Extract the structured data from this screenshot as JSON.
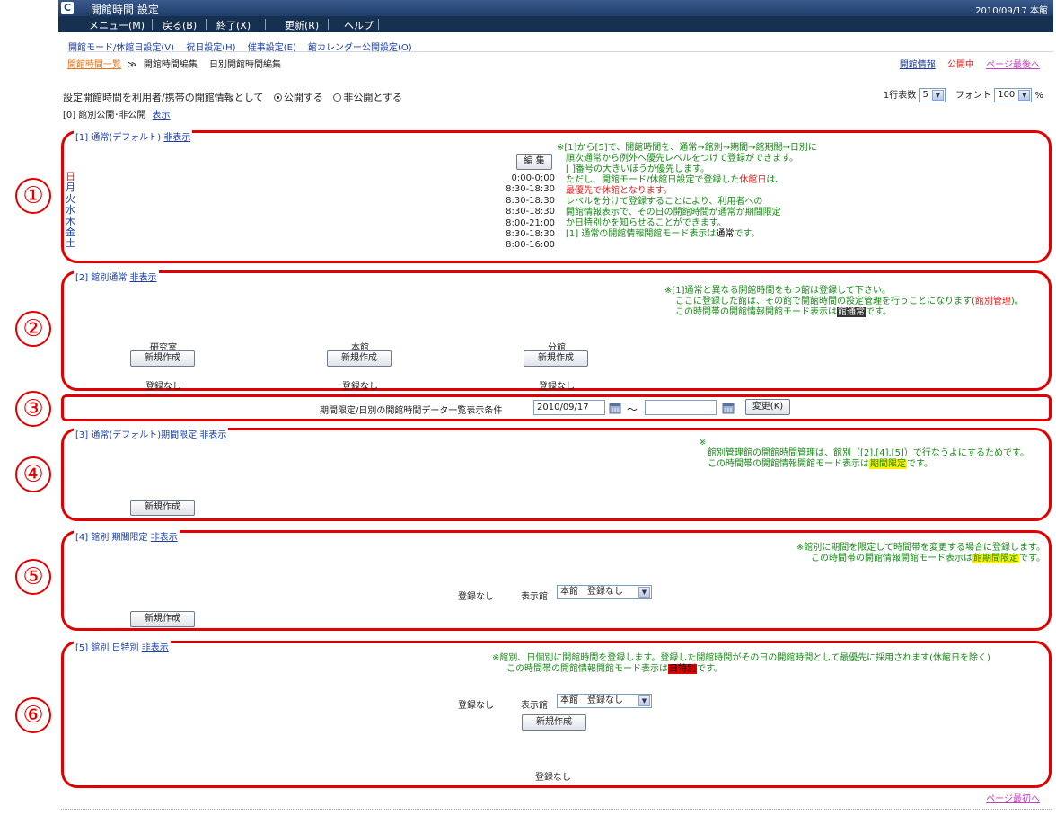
{
  "window": {
    "title": "開館時間 設定",
    "datetime": "2010/09/17 本館",
    "logo": "C"
  },
  "menu": [
    {
      "label": "メニュー(M)"
    },
    {
      "label": "戻る(B)"
    },
    {
      "label": "終了(X)"
    },
    {
      "label": "更新(R)"
    },
    {
      "label": "ヘルプ"
    }
  ],
  "sublinks": [
    "開館モード/休館日設定(V)",
    "祝日設定(H)",
    "催事設定(E)",
    "館カレンダー公開設定(O)"
  ],
  "breadcrumb": {
    "current": "開館時間一覧",
    "sep": "≫",
    "item1": "開館時間編集",
    "item2": "日別開館時間編集"
  },
  "topright": {
    "info_link": "開館情報",
    "status": "公開中",
    "bottom_link": "ページ最後へ"
  },
  "publish": {
    "label": "設定開館時間を利用者/携帯の開館情報として",
    "opt_public": "公開する",
    "opt_private": "非公開とする",
    "selected": "public"
  },
  "display_opts": {
    "rows_label": "1行表数",
    "rows_value": "5",
    "font_label": "フォント",
    "font_value": "100",
    "font_unit": "%"
  },
  "section0": {
    "label": "[0] 館別公開･非公開",
    "link": "表示"
  },
  "section1": {
    "head": "[1] 通常(デフォルト)",
    "toggle": "非表示",
    "edit_button": "編 集",
    "days": [
      "日",
      "月",
      "火",
      "水",
      "木",
      "金",
      "土"
    ],
    "times": [
      "0:00-0:00",
      "8:30-18:30",
      "8:30-18:30",
      "8:30-18:30",
      "8:00-21:00",
      "8:30-18:30",
      "8:00-16:00"
    ],
    "note": {
      "l1": "※[1]から[5]で、開館時間を、通常→館別→期間→館期間→日別に",
      "l2": "順次通常から例外へ優先レベルをつけて登録ができます。",
      "l3": "[ ]番号の大きいほうが優先します。",
      "l4a": "ただし、開館モード/休館日設定で登録した",
      "l4b": "休館日",
      "l4c": "は、",
      "l5": "最優先で休館となります。",
      "l6": "レベルを分けて登録することにより、利用者への",
      "l7": "開館情報表示で、その日の開館時間が通常か期間限定",
      "l8": "か日特別かを知らせることができます。",
      "l9a": "[1] 通常の開館情報開館モード表示は",
      "l9b": "通常",
      "l9c": "です。"
    }
  },
  "section2": {
    "head": "[2] 館別通常",
    "toggle": "非表示",
    "note": {
      "l1": "※[1]通常と異なる開館時間をもつ館は登録して下さい。",
      "l2a": "ここに登録した館は、その館で開館時間の設定管理を行うことになります(",
      "l2b": "館別管理",
      "l2c": ")。",
      "l3a": "この時間帯の開館情報開館モード表示は",
      "l3b": "館通常",
      "l3c": "です。"
    },
    "branches": [
      {
        "name": "研究室",
        "button": "新規作成",
        "status": "登録なし"
      },
      {
        "name": "本館",
        "button": "新規作成",
        "status": "登録なし"
      },
      {
        "name": "分館",
        "button": "新規作成",
        "status": "登録なし"
      }
    ]
  },
  "section3": {
    "label": "期間限定/日別の開館時間データ一覧表示条件",
    "date_from": "2010/09/17",
    "tilde": "～",
    "date_to": "",
    "button": "変更(K)"
  },
  "section4": {
    "head": "[3] 通常(デフォルト)期間限定",
    "toggle": "非表示",
    "note": {
      "l1": "※",
      "l2": "館別管理館の開館時間管理は、館別（[2],[4],[5]）で行なうよにするためです。",
      "l3a": "この時間帯の開館情報開館モード表示は",
      "l3b": "期間限定",
      "l3c": "です。"
    },
    "button": "新規作成"
  },
  "section5": {
    "head": "[4] 館別 期間限定",
    "toggle": "非表示",
    "note": {
      "l1": "※館別に期間を限定して時間帯を変更する場合に登録します。",
      "l2a": "この時間帯の開館情報開館モード表示は",
      "l2b": "館期間限定",
      "l2c": "です。"
    },
    "status": "登録なし",
    "lib_label": "表示館",
    "lib_value": "本館　登録なし",
    "button": "新規作成"
  },
  "section6": {
    "head": "[5] 館別 日特別",
    "toggle": "非表示",
    "note": {
      "l1": "※館別、日個別に開館時間を登録します。登録した開館時間がその日の開館時間として最優先に採用されます(休館日を除く)",
      "l2a": "この時間帯の開館情報開館モード表示は",
      "l2b": "日特別",
      "l2c": "です。"
    },
    "status": "登録なし",
    "lib_label": "表示館",
    "lib_value": "本館　登録なし",
    "button": "新規作成",
    "status_bottom": "登録なし"
  },
  "callouts": [
    "①",
    "②",
    "③",
    "④",
    "⑤",
    "⑥"
  ],
  "footer": {
    "top_link": "ページ最初へ"
  },
  "colors": {
    "callout": "#e00000",
    "note_green": "#188a18",
    "menu_bg": "#16304f"
  }
}
